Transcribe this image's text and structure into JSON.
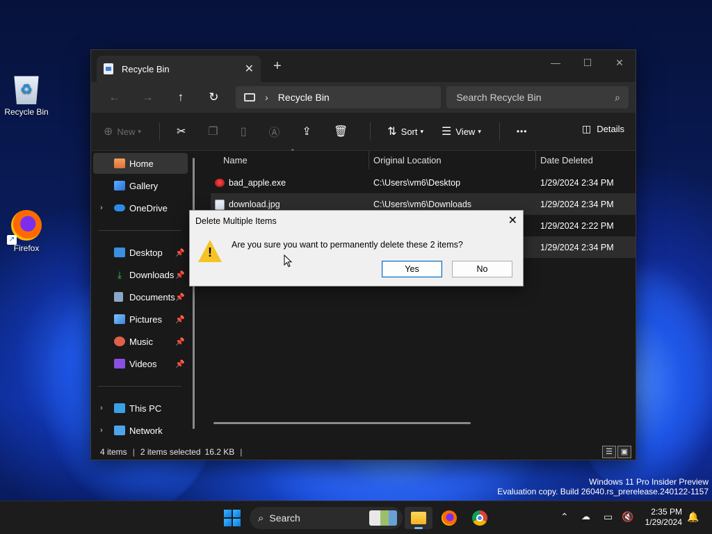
{
  "desktop": {
    "icons": [
      {
        "label": "Recycle Bin"
      },
      {
        "label": "Firefox"
      }
    ]
  },
  "window": {
    "tab_title": "Recycle Bin",
    "address": "Recycle Bin",
    "search_placeholder": "Search Recycle Bin",
    "toolbar": {
      "new_label": "New",
      "sort_label": "Sort",
      "view_label": "View",
      "more_label": "•••",
      "details_label": "Details"
    },
    "sidebar": {
      "home": "Home",
      "gallery": "Gallery",
      "onedrive": "OneDrive",
      "desktop": "Desktop",
      "downloads": "Downloads",
      "documents": "Documents",
      "pictures": "Pictures",
      "music": "Music",
      "videos": "Videos",
      "thispc": "This PC",
      "network": "Network"
    },
    "columns": {
      "name": "Name",
      "original_location": "Original Location",
      "date_deleted": "Date Deleted"
    },
    "rows": [
      {
        "name": "bad_apple.exe",
        "location": "C:\\Users\\vm6\\Desktop",
        "date": "1/29/2024 2:34 PM"
      },
      {
        "name": "download.jpg",
        "location": "C:\\Users\\vm6\\Downloads",
        "date": "1/29/2024 2:34 PM"
      },
      {
        "name": "",
        "location": "",
        "date": "1/29/2024 2:22 PM"
      },
      {
        "name": "",
        "location": "",
        "date": "1/29/2024 2:34 PM"
      }
    ],
    "status": {
      "count": "4 items",
      "selected": "2 items selected",
      "size": "16.2 KB"
    }
  },
  "dialog": {
    "title": "Delete Multiple Items",
    "message": "Are you sure you want to permanently delete these 2 items?",
    "yes": "Yes",
    "no": "No"
  },
  "watermark": {
    "line1": "Windows 11 Pro Insider Preview",
    "line2": "Evaluation copy. Build 26040.rs_prerelease.240122-1157"
  },
  "taskbar": {
    "search_label": "Search",
    "time": "2:35 PM",
    "date": "1/29/2024"
  }
}
